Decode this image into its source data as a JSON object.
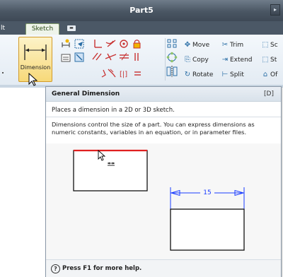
{
  "window": {
    "title": "Part5"
  },
  "tabs": {
    "partial_left": "lt",
    "active": "Sketch"
  },
  "ribbon": {
    "dimension_label": "Dimension",
    "modify": {
      "move": "Move",
      "trim": "Trim",
      "scale_partial": "Sc",
      "copy": "Copy",
      "extend": "Extend",
      "stretch_partial": "St",
      "rotate": "Rotate",
      "split": "Split",
      "offset_partial": "Of"
    }
  },
  "tooltip": {
    "name": "General Dimension",
    "shortcut": "[D]",
    "short_desc": "Places a dimension in a 2D or 3D sketch.",
    "long_desc": "Dimensions control the size of a part. You can express dimensions as numeric constants, variables in an equation, or in parameter files.",
    "figure_value": "15",
    "help": "Press F1 for more help."
  },
  "colors": {
    "highlight_edge": "#e02020",
    "dimension_blue": "#1a3cff",
    "button_hover": "#f7d979"
  }
}
